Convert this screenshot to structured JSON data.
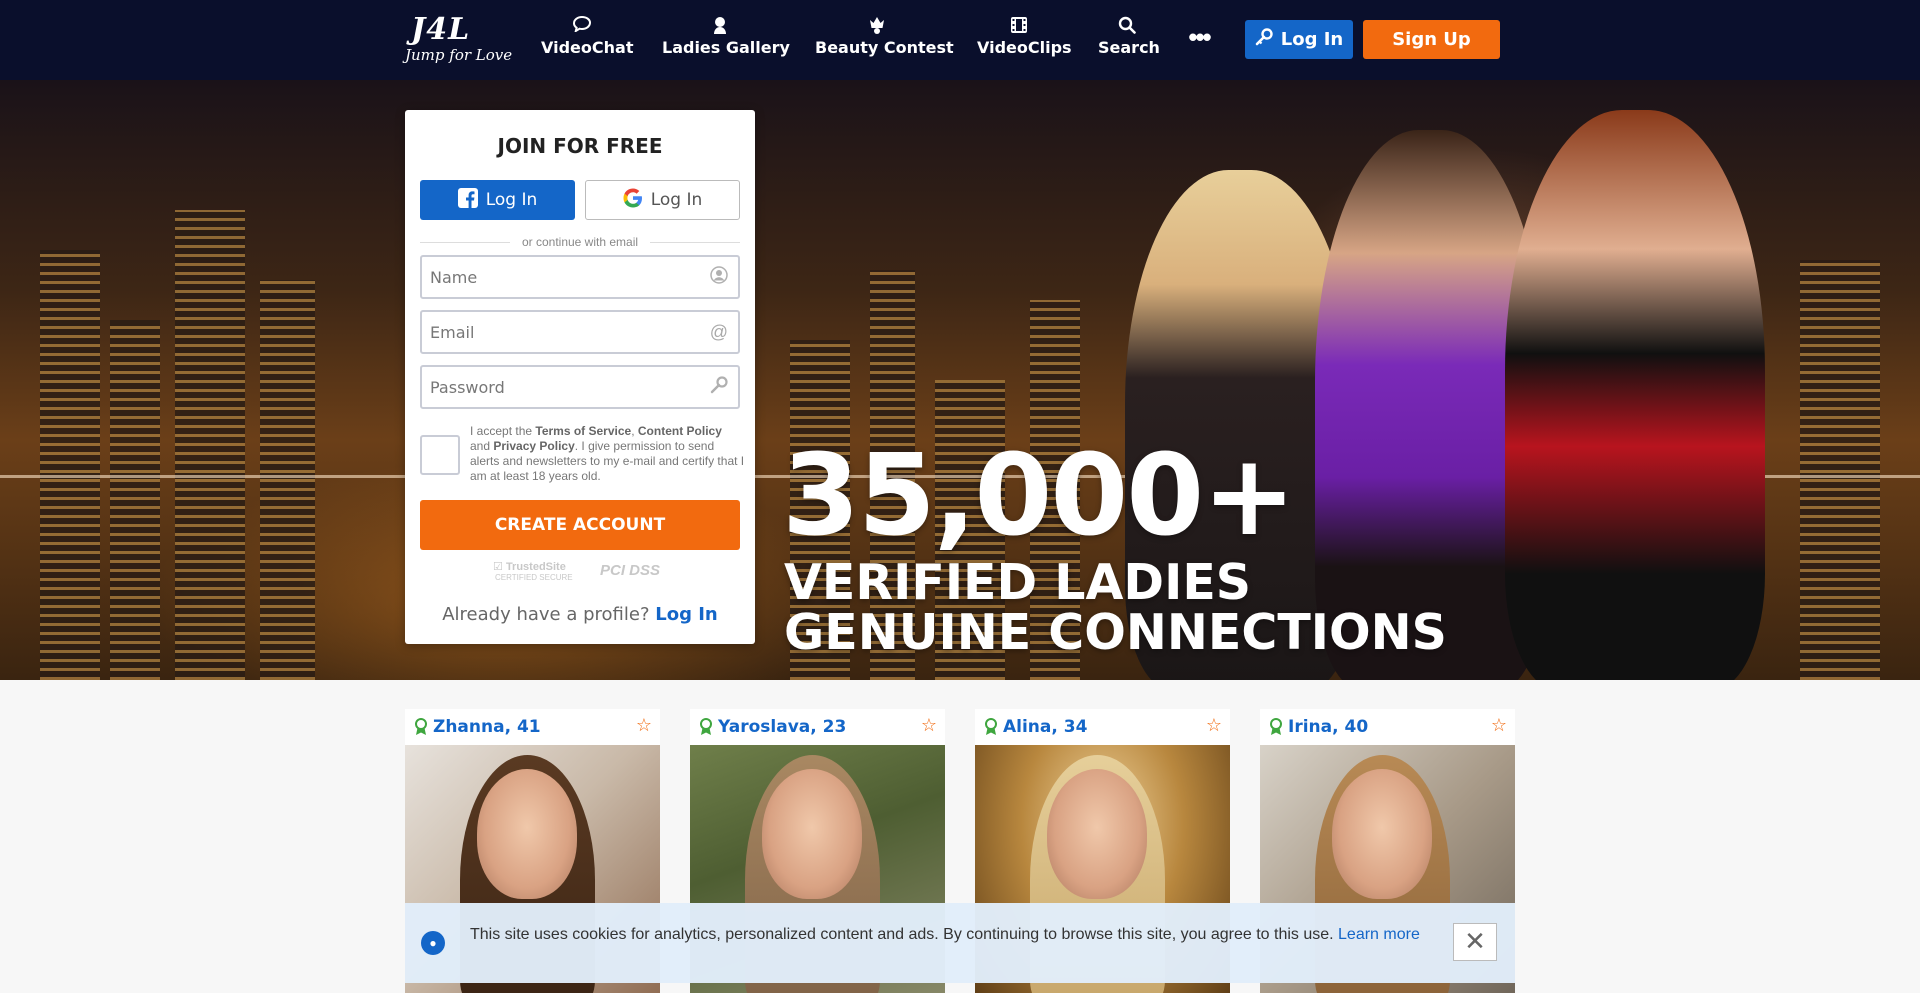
{
  "header": {
    "logo_big": "J4L",
    "logo_small": "Jump for Love",
    "nav": [
      {
        "label": "VideoChat",
        "icon": "chat-bubble-icon"
      },
      {
        "label": "Ladies Gallery",
        "icon": "lady-icon"
      },
      {
        "label": "Beauty Contest",
        "icon": "crown-icon"
      },
      {
        "label": "VideoClips",
        "icon": "film-icon"
      },
      {
        "label": "Search",
        "icon": "search-icon"
      }
    ],
    "more_label": "•••",
    "login_label": "Log In",
    "signup_label": "Sign Up"
  },
  "hero": {
    "big_number": "35,000+",
    "line1": "VERIFIED LADIES",
    "line2": "GENUINE CONNECTIONS"
  },
  "join": {
    "title": "JOIN FOR FREE",
    "facebook_label": "Log In",
    "google_label": "Log In",
    "divider_text": "or continue with email",
    "name_placeholder": "Name",
    "email_placeholder": "Email",
    "password_placeholder": "Password",
    "terms_prefix": "I accept the ",
    "terms_link1": "Terms of Service",
    "terms_sep": ", ",
    "terms_link2": "Content Policy",
    "terms_and": " and ",
    "terms_link3": "Privacy Policy",
    "terms_suffix": ". I give permission to send alerts and newsletters to my e-mail and certify that I am at least 18 years old.",
    "create_label": "CREATE ACCOUNT",
    "trusted_site": "TrustedSite",
    "trusted_sub": "CERTIFIED SECURE",
    "pci_label": "PCI DSS",
    "already_text": "Already have a profile?",
    "already_link": "Log In"
  },
  "profiles": [
    {
      "name": "Zhanna, 41"
    },
    {
      "name": "Yaroslava, 23"
    },
    {
      "name": "Alina, 34"
    },
    {
      "name": "Irina, 40"
    }
  ],
  "cookie": {
    "text": "This site uses cookies for analytics, personalized content and ads. By continuing to browse this site, you agree to this use.",
    "link": "Learn more",
    "close_label": "✕"
  },
  "colors": {
    "header_bg": "#0a0f2c",
    "accent_blue": "#1466c8",
    "accent_orange": "#f26a0f",
    "verified_green": "#3fa63f"
  }
}
